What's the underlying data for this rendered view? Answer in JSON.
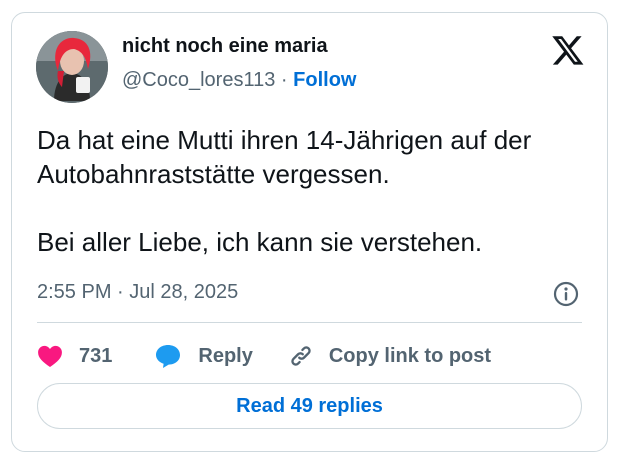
{
  "author": {
    "name": "nicht noch eine maria",
    "handle": "@Coco_lores113",
    "separator": "·",
    "follow_label": "Follow"
  },
  "tweet": {
    "paragraphs": [
      "Da hat eine Mutti ihren 14-Jährigen auf der Autobahnraststätte vergessen.",
      "Bei aller Liebe, ich kann sie verstehen."
    ],
    "timestamp": "2:55 PM · Jul 28, 2025"
  },
  "actions": {
    "like_count": "731",
    "reply_label": "Reply",
    "copy_label": "Copy link to post"
  },
  "footer": {
    "read_replies_label": "Read 49 replies"
  },
  "icons": {
    "logo": "x-logo-icon",
    "info": "info-icon",
    "like": "heart-icon",
    "reply": "speech-bubble-icon",
    "copy": "link-icon"
  },
  "colors": {
    "link": "#006fd6",
    "heart": "#f91880",
    "reply_bubble": "#1d9bf0",
    "secondary_text": "#536471",
    "border": "#cfd9de"
  }
}
